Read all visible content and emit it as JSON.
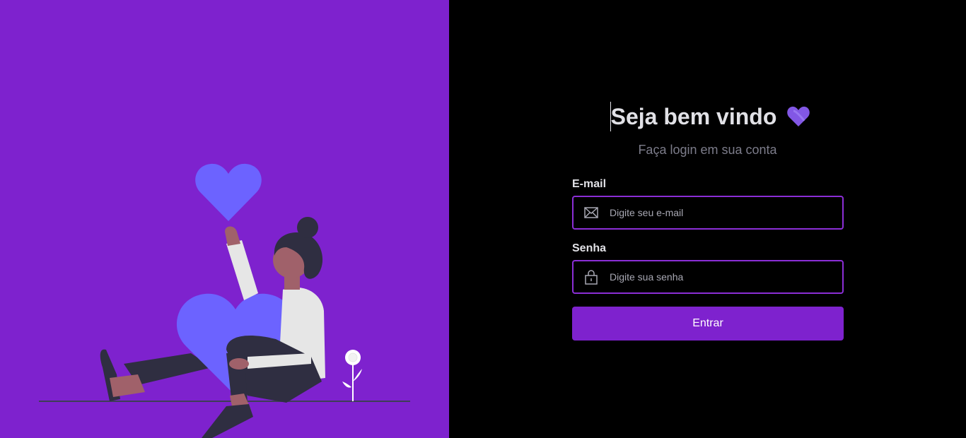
{
  "login": {
    "title": "Seja bem vindo",
    "subtitle": "Faça login em sua conta",
    "email_label": "E-mail",
    "email_placeholder": "Digite seu e-mail",
    "password_label": "Senha",
    "password_placeholder": "Digite sua senha",
    "submit_label": "Entrar"
  },
  "colors": {
    "accent": "#7e22ce",
    "background": "#000000",
    "heart": "#6c63ff",
    "title_heart": "#8257e5"
  },
  "icons": {
    "title": "heart-icon",
    "email": "mail-icon",
    "password": "lock-icon"
  }
}
